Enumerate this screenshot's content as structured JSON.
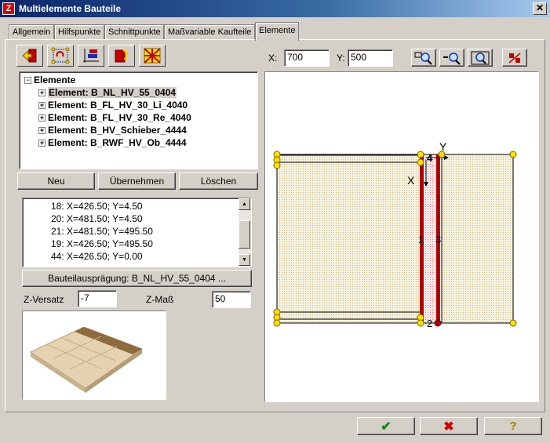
{
  "window": {
    "title": "Multielemente Bauteile",
    "app_icon": "Z",
    "close_symbol": "✕"
  },
  "tabs": [
    "Allgemein",
    "Hilfspunkte",
    "Schnittpunkte",
    "Maßvariable Kaufteile",
    "Elemente"
  ],
  "active_tab": "Elemente",
  "toolbar": {
    "icons": [
      "exit-door-icon",
      "rotate-element-icon",
      "align-axes-icon",
      "import-part-icon",
      "grid-pattern-icon"
    ]
  },
  "coords": {
    "x_label": "X:",
    "x_value": "700",
    "y_label": "Y:",
    "y_value": "500"
  },
  "zoom": {
    "icons": [
      "zoom-in-icon",
      "zoom-out-icon",
      "zoom-fit-icon",
      "toggle-markers-icon"
    ]
  },
  "tree": {
    "root": "Elemente",
    "items": [
      "Element: B_NL_HV_55_0404",
      "Element: B_FL_HV_30_Li_4040",
      "Element: B_FL_HV_30_Re_4040",
      "Element: B_HV_Schieber_4444",
      "Element: B_RWF_HV_Ob_4444"
    ]
  },
  "buttons": {
    "new": "Neu",
    "apply": "Übernehmen",
    "delete": "Löschen"
  },
  "points": [
    "18: X=426.50; Y=4.50",
    "20: X=481.50; Y=4.50",
    "21: X=481.50; Y=495.50",
    "19: X=426.50; Y=495.50",
    "44: X=426.50; Y=0.00"
  ],
  "variant_button": "Bauteilausprägung: B_NL_HV_55_0404 ...",
  "z_offset": {
    "label": "Z-Versatz",
    "value": "-7"
  },
  "z_dim": {
    "label": "Z-Maß",
    "value": "50"
  },
  "drawing": {
    "axis_x": "X",
    "axis_y": "Y",
    "markers": [
      "1",
      "2",
      "3",
      "4"
    ],
    "colors": {
      "fill": "#f2efd8",
      "accent": "#b00000",
      "handle": "#ffe000"
    }
  },
  "footer": {
    "ok": "✔",
    "cancel": "✖",
    "help": "?"
  }
}
